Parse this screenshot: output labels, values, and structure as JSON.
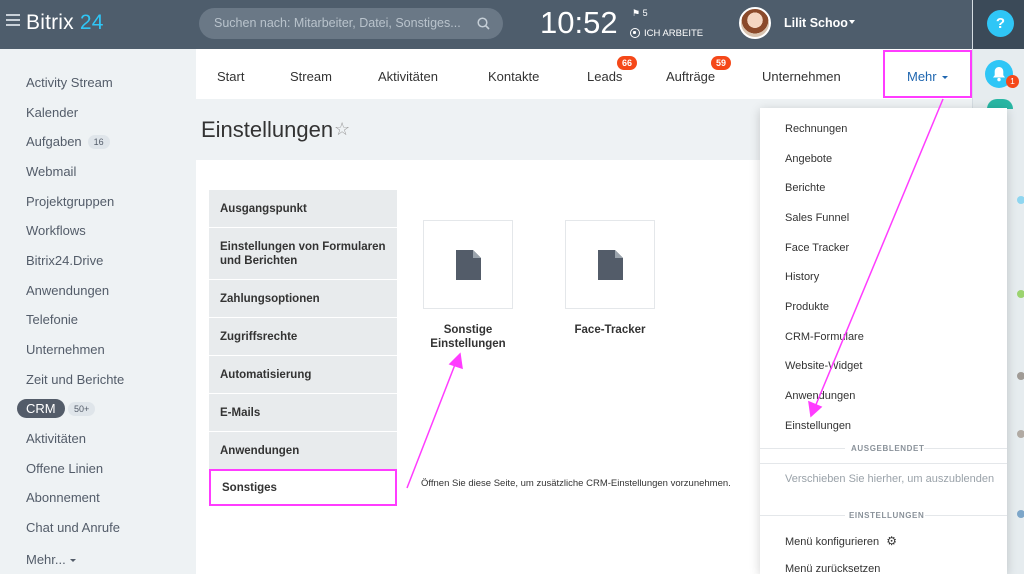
{
  "header": {
    "logo_main": "Bitrix",
    "logo_accent": "24",
    "search_placeholder": "Suchen nach: Mitarbeiter, Datei, Sonstiges...",
    "clock": "10:52",
    "flag_count": "5",
    "work_status": "ICH ARBEITE",
    "user_name": "Lilit Schoo"
  },
  "right_panel": {
    "help_label": "?",
    "notification_count": "1"
  },
  "sidebar": {
    "items": [
      {
        "label": "Activity Stream"
      },
      {
        "label": "Kalender"
      },
      {
        "label": "Aufgaben",
        "counter": "16"
      },
      {
        "label": "Webmail"
      },
      {
        "label": "Projektgruppen"
      },
      {
        "label": "Workflows"
      },
      {
        "label": "Bitrix24.Drive"
      },
      {
        "label": "Anwendungen"
      },
      {
        "label": "Telefonie"
      },
      {
        "label": "Unternehmen"
      },
      {
        "label": "Zeit und Berichte"
      },
      {
        "label": "CRM",
        "counter": "50+"
      },
      {
        "label": "Aktivitäten"
      },
      {
        "label": "Offene Linien"
      },
      {
        "label": "Abonnement"
      },
      {
        "label": "Chat und Anrufe"
      },
      {
        "label": "Mehr..."
      }
    ]
  },
  "navbar": {
    "tabs": [
      {
        "label": "Start"
      },
      {
        "label": "Stream"
      },
      {
        "label": "Aktivitäten"
      },
      {
        "label": "Kontakte"
      },
      {
        "label": "Leads",
        "badge": "66"
      },
      {
        "label": "Aufträge",
        "badge": "59"
      },
      {
        "label": "Unternehmen"
      },
      {
        "label": "Mehr"
      }
    ]
  },
  "page": {
    "title": "Einstellungen",
    "settings_menu": [
      {
        "label": "Ausgangspunkt"
      },
      {
        "label": "Einstellungen von Formularen und Berichten"
      },
      {
        "label": "Zahlungsoptionen"
      },
      {
        "label": "Zugriffsrechte"
      },
      {
        "label": "Automatisierung"
      },
      {
        "label": "E-Mails"
      },
      {
        "label": "Anwendungen"
      },
      {
        "label": "Sonstiges"
      }
    ],
    "tiles": [
      {
        "label": "Sonstige Einstellungen"
      },
      {
        "label": "Face-Tracker"
      }
    ],
    "description": "Öffnen Sie diese Seite, um zusätzliche CRM-Einstellungen vorzunehmen."
  },
  "dropdown": {
    "items": [
      {
        "label": "Rechnungen"
      },
      {
        "label": "Angebote"
      },
      {
        "label": "Berichte"
      },
      {
        "label": "Sales Funnel"
      },
      {
        "label": "Face Tracker"
      },
      {
        "label": "History"
      },
      {
        "label": "Produkte"
      },
      {
        "label": "CRM-Formulare"
      },
      {
        "label": "Website-Widget"
      },
      {
        "label": "Anwendungen"
      },
      {
        "label": "Einstellungen"
      }
    ],
    "hidden_header": "AUSGEBLENDET",
    "hidden_hint": "Verschieben Sie hierher, um auszublenden",
    "settings_header": "EINSTELLUNGEN",
    "configure_label": "Menü konfigurieren",
    "reset_label": "Menü zurücksetzen"
  },
  "colors": {
    "annotation": "#ff3cff",
    "accent": "#2fc6f6",
    "badge": "#f54819",
    "topbar": "#4e5d6c"
  }
}
